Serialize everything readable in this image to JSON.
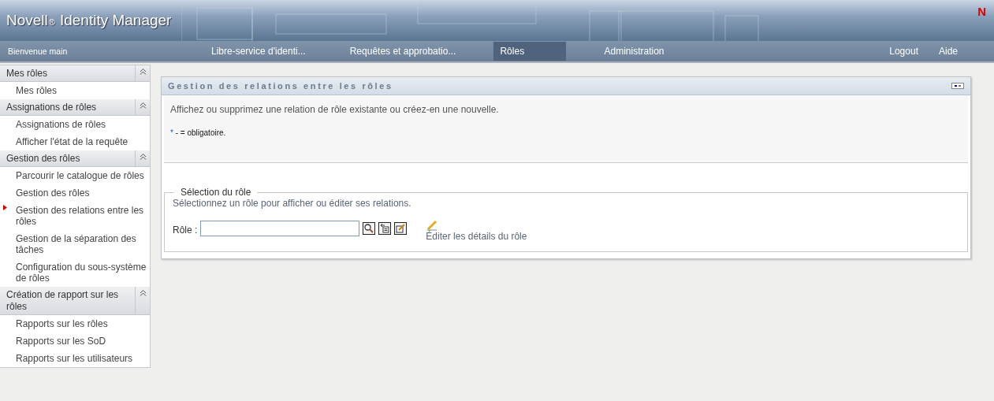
{
  "header": {
    "brand": "Novell",
    "registered": "®",
    "product": "Identity Manager",
    "logo": "N"
  },
  "nav": {
    "welcome": "Bienvenue main",
    "tabs": [
      {
        "label": "Libre-service d'identi...",
        "selected": false
      },
      {
        "label": "Requêtes et approbatio...",
        "selected": false
      },
      {
        "label": "Rôles",
        "selected": true
      },
      {
        "label": "Administration",
        "selected": false
      }
    ],
    "links": [
      "Logout",
      "Aide"
    ]
  },
  "sidebar": {
    "sections": [
      {
        "title": "Mes rôles",
        "expanded": true,
        "items": [
          {
            "label": "Mes rôles",
            "selected": false
          }
        ]
      },
      {
        "title": "Assignations de rôles",
        "expanded": true,
        "items": [
          {
            "label": "Assignations de rôles",
            "selected": false
          },
          {
            "label": "Afficher l'état de la requête",
            "selected": false
          }
        ]
      },
      {
        "title": "Gestion des rôles",
        "expanded": true,
        "items": [
          {
            "label": "Parcourir le catalogue de rôles",
            "selected": false
          },
          {
            "label": "Gestion des rôles",
            "selected": false
          },
          {
            "label": "Gestion des relations entre les rôles",
            "selected": true
          },
          {
            "label": "Gestion de la séparation des tâches",
            "selected": false
          },
          {
            "label": "Configuration du sous-système de rôles",
            "selected": false
          }
        ]
      },
      {
        "title": "Création de rapport sur les rôles",
        "expanded": true,
        "items": [
          {
            "label": "Rapports sur les rôles",
            "selected": false
          },
          {
            "label": "Rapports sur les SoD",
            "selected": false
          },
          {
            "label": "Rapports sur les utilisateurs",
            "selected": false
          }
        ]
      }
    ]
  },
  "panel": {
    "title": "Gestion des relations entre les rôles",
    "description": "Affichez ou supprimez une relation de rôle existante ou créez-en une nouvelle.",
    "required_mark": "*",
    "required_note": " - = obligatoire.",
    "fieldset": {
      "legend": "Sélection du rôle",
      "hint": "Sélectionnez un rôle pour afficher ou éditer ses relations.",
      "field_label": "Rôle :",
      "edit_link": "Éditer les détails du rôle"
    }
  }
}
